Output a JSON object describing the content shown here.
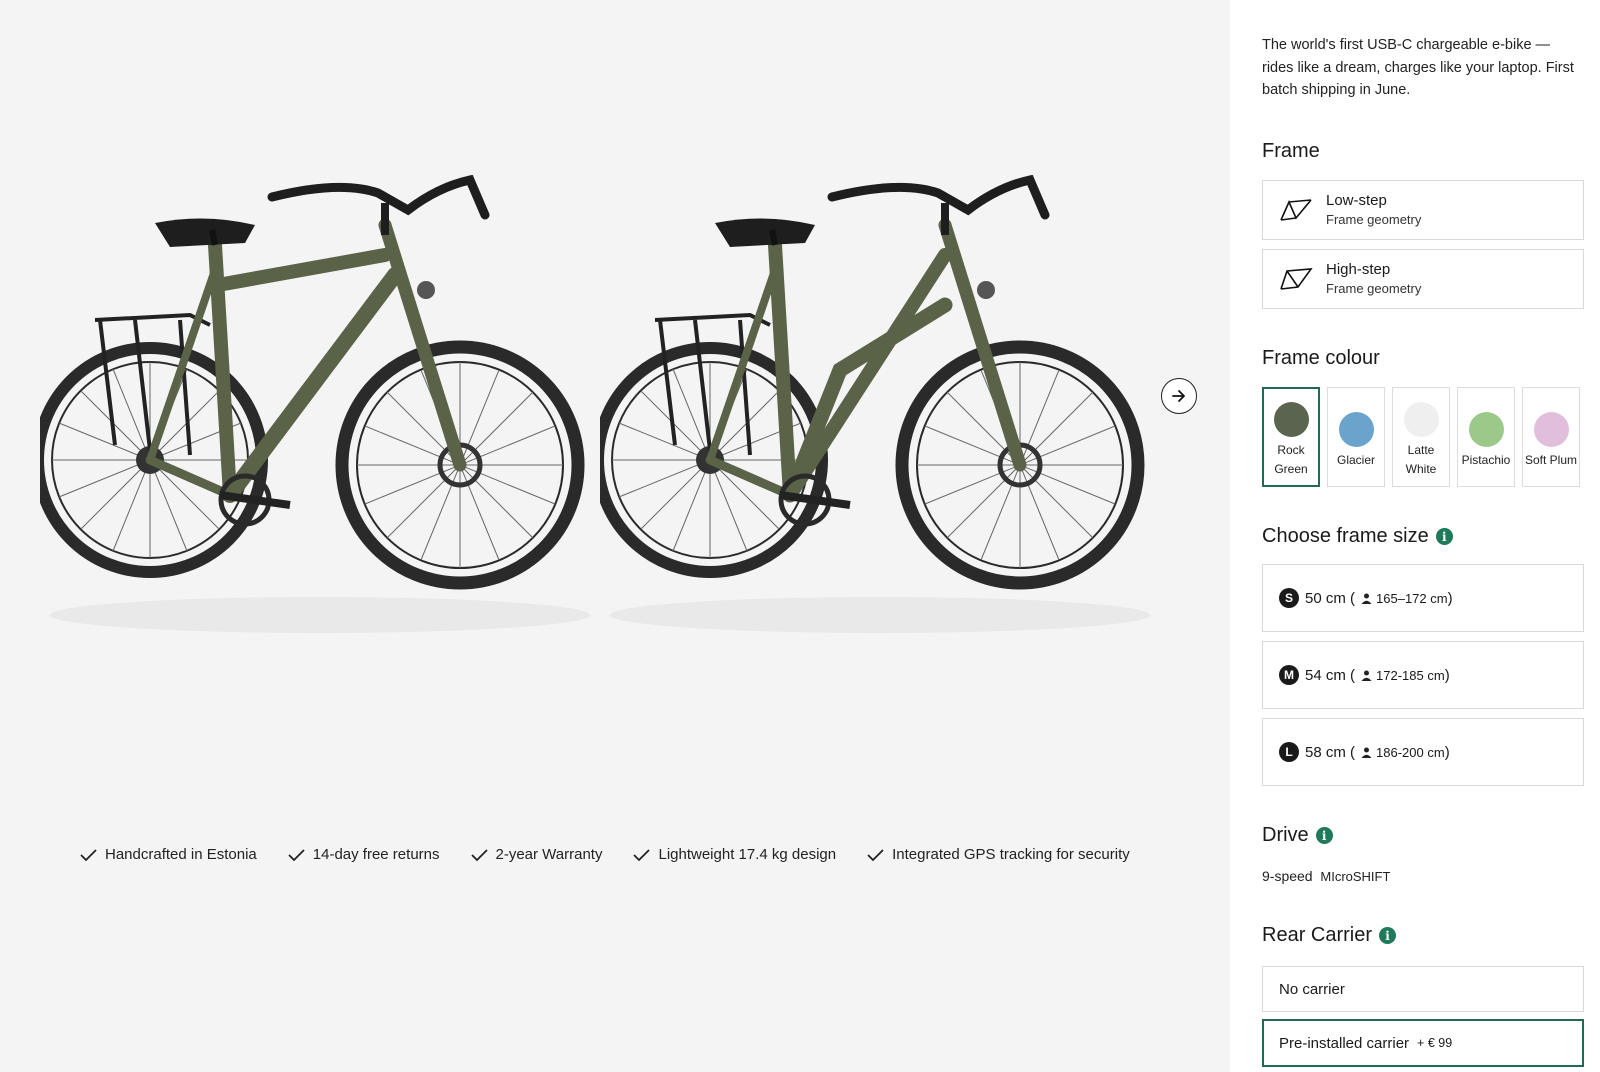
{
  "gallery": {
    "bikes": [
      {
        "name": "high-step-bike-image",
        "frame_color": "#5a6248"
      },
      {
        "name": "low-step-bike-image",
        "frame_color": "#5a6248"
      }
    ],
    "next_icon": "arrow-right-icon",
    "usps": [
      "Handcrafted in Estonia",
      "14-day free returns",
      "2-year Warranty",
      "Lightweight 17.4 kg design",
      "Integrated GPS tracking for security"
    ]
  },
  "panel": {
    "intro": "The world's first USB-C chargeable e-bike — rides like a dream, charges like your laptop. First batch shipping in June.",
    "frame": {
      "heading": "Frame",
      "options": [
        {
          "label": "Low-step",
          "sub": "Frame geometry",
          "icon": "low-step-frame-icon"
        },
        {
          "label": "High-step",
          "sub": "Frame geometry",
          "icon": "high-step-frame-icon"
        }
      ]
    },
    "colour": {
      "heading": "Frame colour",
      "options": [
        {
          "label": "Rock Green",
          "line1": "Rock",
          "line2": "Green",
          "color": "#5a644e",
          "selected": true
        },
        {
          "label": "Glacier",
          "line1": "Glacier",
          "line2": "",
          "color": "#6aa3cc",
          "selected": false
        },
        {
          "label": "Latte White",
          "line1": "Latte",
          "line2": "White",
          "color": "#efefef",
          "selected": false
        },
        {
          "label": "Pistachio",
          "line1": "Pistachio",
          "line2": "",
          "color": "#9cc98a",
          "selected": false
        },
        {
          "label": "Soft Plum",
          "line1": "Soft Plum",
          "line2": "",
          "color": "#e1bedb",
          "selected": false
        }
      ]
    },
    "size": {
      "heading": "Choose frame size",
      "options": [
        {
          "badge": "S",
          "cm": "50 cm",
          "range": "165–172 cm"
        },
        {
          "badge": "M",
          "cm": "54 cm",
          "range": "172-185 cm"
        },
        {
          "badge": "L",
          "cm": "58 cm",
          "range": "186-200 cm"
        }
      ]
    },
    "drive": {
      "heading": "Drive",
      "value": "9-speed",
      "brand": "MIcroSHIFT"
    },
    "carrier": {
      "heading": "Rear Carrier",
      "options": [
        {
          "label": "No carrier",
          "price": "",
          "selected": false
        },
        {
          "label": "Pre-installed carrier",
          "price": "+ € 99",
          "selected": true
        }
      ]
    },
    "accent": "#1e6b57"
  }
}
